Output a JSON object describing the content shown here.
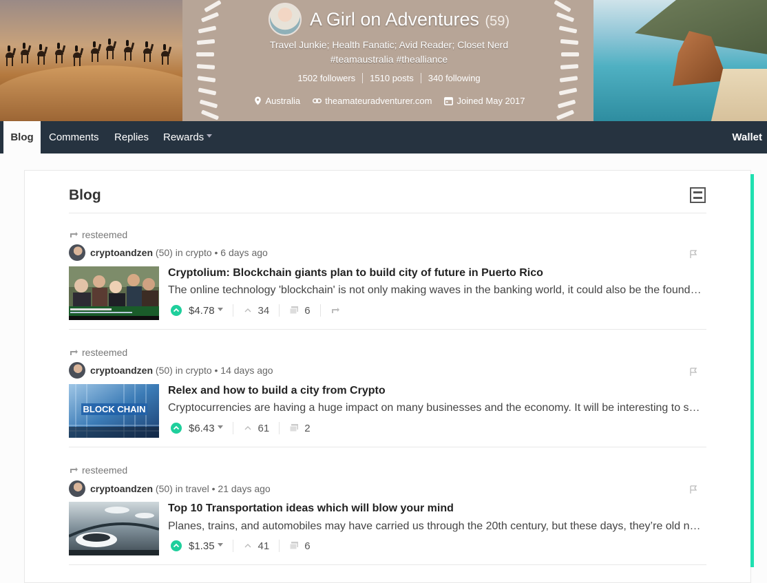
{
  "profile": {
    "name": "A Girl on Adventures",
    "reputation": "(59)",
    "about_line1": "Travel Junkie; Health Fanatic; Avid Reader; Closet Nerd",
    "about_line2": "#teamaustralia #thealliance",
    "followers": "1502 followers",
    "posts": "1510 posts",
    "following": "340 following",
    "location": "Australia",
    "website": "theamateuradventurer.com",
    "joined": "Joined May 2017"
  },
  "nav": {
    "tabs": [
      {
        "label": "Blog",
        "active": true
      },
      {
        "label": "Comments"
      },
      {
        "label": "Replies"
      },
      {
        "label": "Rewards"
      }
    ],
    "wallet": "Wallet"
  },
  "blog": {
    "title": "Blog",
    "posts": [
      {
        "resteemed": "resteemed",
        "author": "cryptoandzen",
        "rep": "(50)",
        "in_text": "in",
        "category": "crypto",
        "age": "• 6 days ago",
        "title": "Cryptolium: Blockchain giants plan to build city of future in Puerto Rico",
        "body": "The online technology 'blockchain' is not only making waves in the banking world, it could also be the foundation of new cities built from scratch.",
        "payout": "$4.78",
        "votes": "34",
        "comments": "6"
      },
      {
        "resteemed": "resteemed",
        "author": "cryptoandzen",
        "rep": "(50)",
        "in_text": "in",
        "category": "crypto",
        "age": "• 14 days ago",
        "title": "Relex and how to build a city from Crypto",
        "body": "Cryptocurrencies are having a huge impact on many businesses and the economy. It will be interesting to see how this unfolds.",
        "payout": "$6.43",
        "votes": "61",
        "comments": "2",
        "thumb_text": "BLOCK CHAIN"
      },
      {
        "resteemed": "resteemed",
        "author": "cryptoandzen",
        "rep": "(50)",
        "in_text": "in",
        "category": "travel",
        "age": "• 21 days ago",
        "title": "Top 10 Transportation ideas which will blow your mind",
        "body": "Planes, trains, and automobiles may have carried us through the 20th century, but these days, they’re old news.",
        "payout": "$1.35",
        "votes": "41",
        "comments": "6"
      }
    ]
  },
  "icons": {
    "location": "map-pin-icon",
    "website": "link-icon",
    "joined": "calendar-icon",
    "resteem": "resteem-icon",
    "flag": "flag-icon",
    "upvote": "upvote-icon",
    "comments": "comments-icon"
  },
  "colors": {
    "nav_bg": "#263340",
    "accent": "#1fcf9c",
    "scroll_accent": "#1fe0b0"
  }
}
